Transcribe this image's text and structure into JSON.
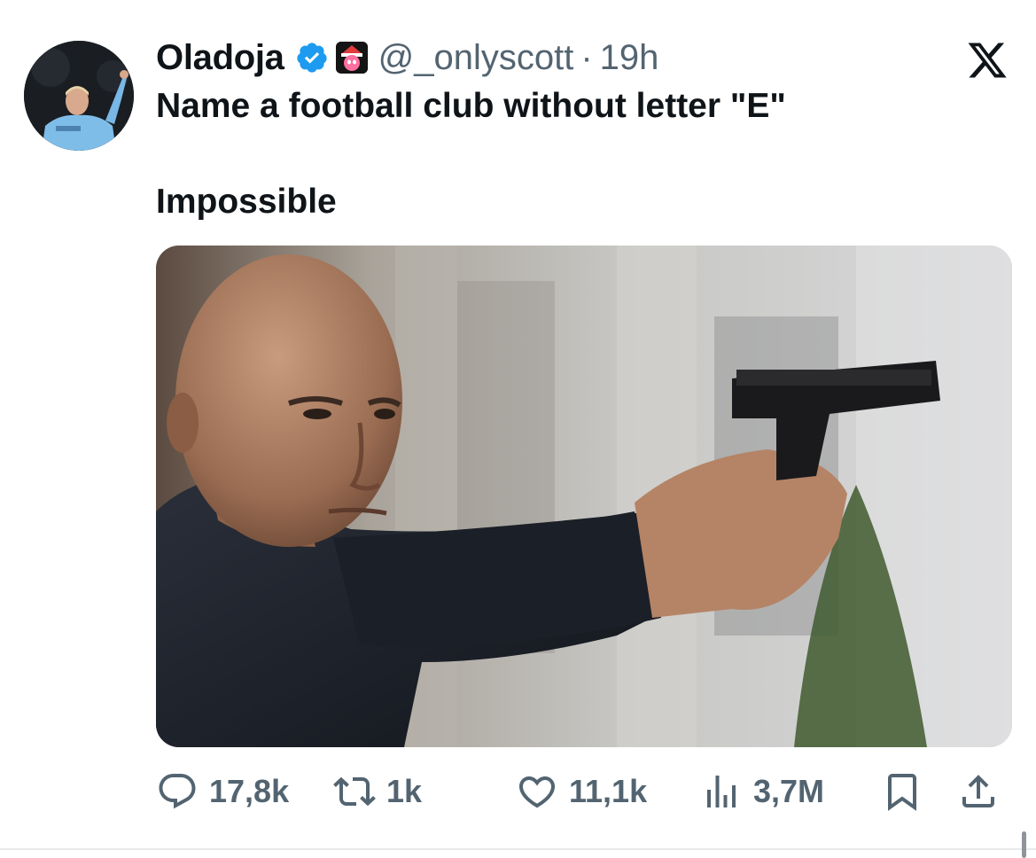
{
  "author": {
    "display_name": "Oladoja",
    "handle": "@_onlyscott",
    "separator": "·",
    "time": "19h",
    "verified_icon": "verified-badge-icon",
    "affiliate_icon": "affiliate-badge-icon"
  },
  "tweet": {
    "line1": "Name a football club without letter \"E\"",
    "line2": "Impossible"
  },
  "actions": {
    "replies": "17,8k",
    "reposts": "1k",
    "likes": "11,1k",
    "views": "3,7M"
  },
  "colors": {
    "text_primary": "#0f1419",
    "text_secondary": "#536471",
    "verified_blue": "#1d9bf0"
  }
}
